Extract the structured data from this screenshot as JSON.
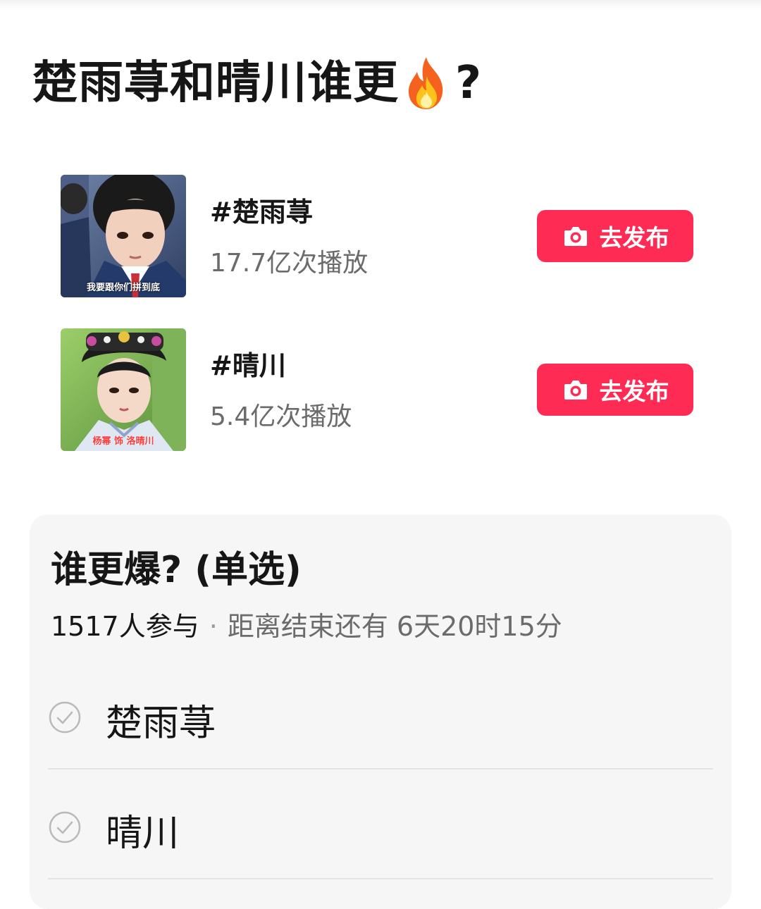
{
  "title": {
    "text_before": "楚雨荨和晴川谁更",
    "emoji": "fire-icon",
    "text_after": "?"
  },
  "topics": [
    {
      "name": "#楚雨荨",
      "plays": "17.7亿次播放",
      "thumb_caption": "我要跟你们拼到底",
      "button_label": "去发布",
      "button_icon": "camera-icon"
    },
    {
      "name": "#晴川",
      "plays": "5.4亿次播放",
      "thumb_caption": "杨幂 饰 洛晴川",
      "button_label": "去发布",
      "button_icon": "camera-icon"
    }
  ],
  "vote": {
    "question": "谁更爆? (单选)",
    "participants": "1517人参与",
    "separator": "·",
    "deadline": "距离结束还有 6天20时15分",
    "options": [
      {
        "label": "楚雨荨",
        "icon": "check-circle-icon"
      },
      {
        "label": "晴川",
        "icon": "check-circle-icon"
      }
    ]
  },
  "colors": {
    "accent": "#fe2c55",
    "text": "#161616",
    "muted": "#6b6b6b",
    "card_bg": "#f6f6f6"
  }
}
